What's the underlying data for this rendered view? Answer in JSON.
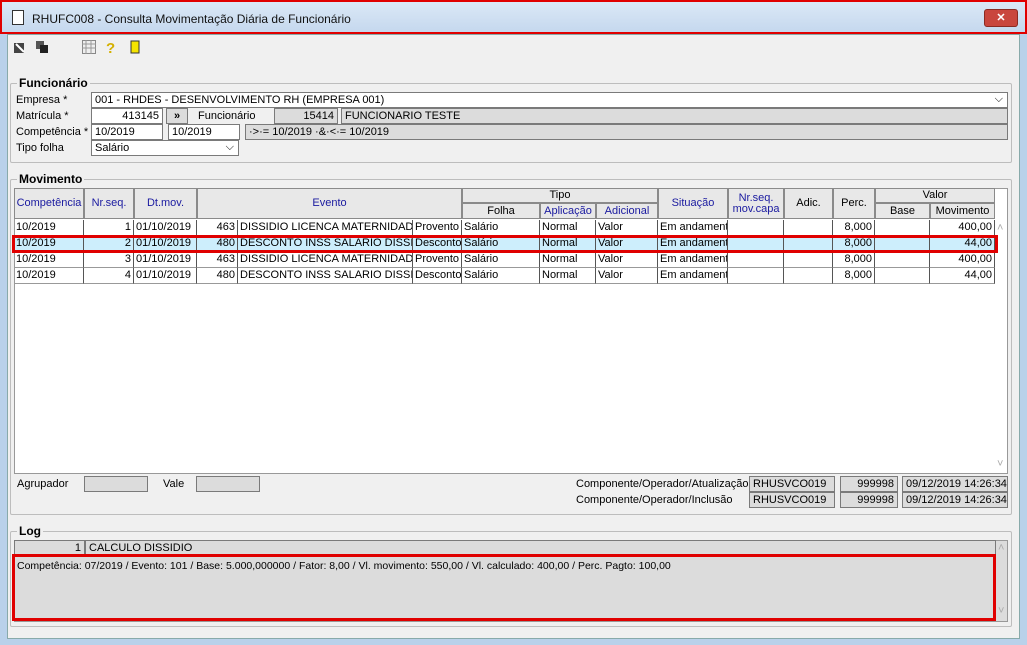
{
  "window": {
    "title": "RHUFC008 - Consulta Movimentação Diária de Funcionário",
    "close_label": "✕"
  },
  "toolbar": {
    "icons": [
      "export-icon",
      "copy-icon",
      "grid-icon",
      "help-icon",
      "exit-door-icon"
    ]
  },
  "funcionario": {
    "legend": "Funcionário",
    "empresa_label": "Empresa *",
    "empresa_value": "001 - RHDES - DESENVOLVIMENTO RH (EMPRESA 001)",
    "matricula_label": "Matrícula *",
    "matricula_value": "413145",
    "lookup_label": "»",
    "funcionario_label": "Funcionário",
    "funcionario_code": "15414",
    "funcionario_name": "FUNCIONARIO TESTE",
    "competencia_label": "Competência *",
    "competencia_from": "10/2019",
    "competencia_to": "10/2019",
    "competencia_expr": "·>·= 10/2019 ·&·<·= 10/2019",
    "tipo_folha_label": "Tipo folha",
    "tipo_folha_value": "Salário"
  },
  "movimento": {
    "legend": "Movimento",
    "headers": {
      "competencia": "Competência",
      "nrseq": "Nr.seq.",
      "dtmov": "Dt.mov.",
      "evento": "Evento",
      "tipo": "Tipo",
      "folha": "Folha",
      "aplicacao": "Aplicação",
      "adicional": "Adicional",
      "situacao": "Situação",
      "nrseqcapa": "Nr.seq. mov.capa",
      "adic": "Adic.",
      "perc": "Perc.",
      "valor": "Valor",
      "base": "Base",
      "movimento": "Movimento"
    },
    "rows": [
      [
        "10/2019",
        "1",
        "01/10/2019",
        "463",
        "DISSIDIO LICENCA MATERNIDADE",
        "Provento",
        "Salário",
        "Normal",
        "Valor",
        "Em andament",
        "",
        "",
        "8,000",
        "",
        "400,00"
      ],
      [
        "10/2019",
        "2",
        "01/10/2019",
        "480",
        "DESCONTO INSS SALARIO DISSIDIO",
        "Desconto",
        "Salário",
        "Normal",
        "Valor",
        "Em andament",
        "",
        "",
        "8,000",
        "",
        "44,00"
      ],
      [
        "10/2019",
        "3",
        "01/10/2019",
        "463",
        "DISSIDIO LICENCA MATERNIDADE",
        "Provento",
        "Salário",
        "Normal",
        "Valor",
        "Em andament",
        "",
        "",
        "8,000",
        "",
        "400,00"
      ],
      [
        "10/2019",
        "4",
        "01/10/2019",
        "480",
        "DESCONTO INSS SALARIO DISSIDIO",
        "Desconto",
        "Salário",
        "Normal",
        "Valor",
        "Em andament",
        "",
        "",
        "8,000",
        "",
        "44,00"
      ]
    ],
    "selected_row": 1,
    "agrupador_label": "Agrupador",
    "vale_label": "Vale",
    "atualizacao_label": "Componente/Operador/Atualização",
    "atualizacao": [
      "RHUSVCO019",
      "999998",
      "09/12/2019 14:26:34"
    ],
    "inclusao_label": "Componente/Operador/Inclusão",
    "inclusao": [
      "RHUSVCO019",
      "999998",
      "09/12/2019 14:26:34"
    ]
  },
  "log": {
    "legend": "Log",
    "seq": "1",
    "title": "CALCULO DISSIDIO",
    "detail": "Competência: 07/2019 / Evento: 101 / Base: 5.000,000000 / Fator: 8,00 / Vl. movimento: 550,00 / Vl. calculado: 400,00 / Perc. Pagto: 100,00"
  },
  "colors": {
    "highlight": "#e00000",
    "selected_row": "#cdeefc",
    "header_blue": "#1a1aa0"
  }
}
